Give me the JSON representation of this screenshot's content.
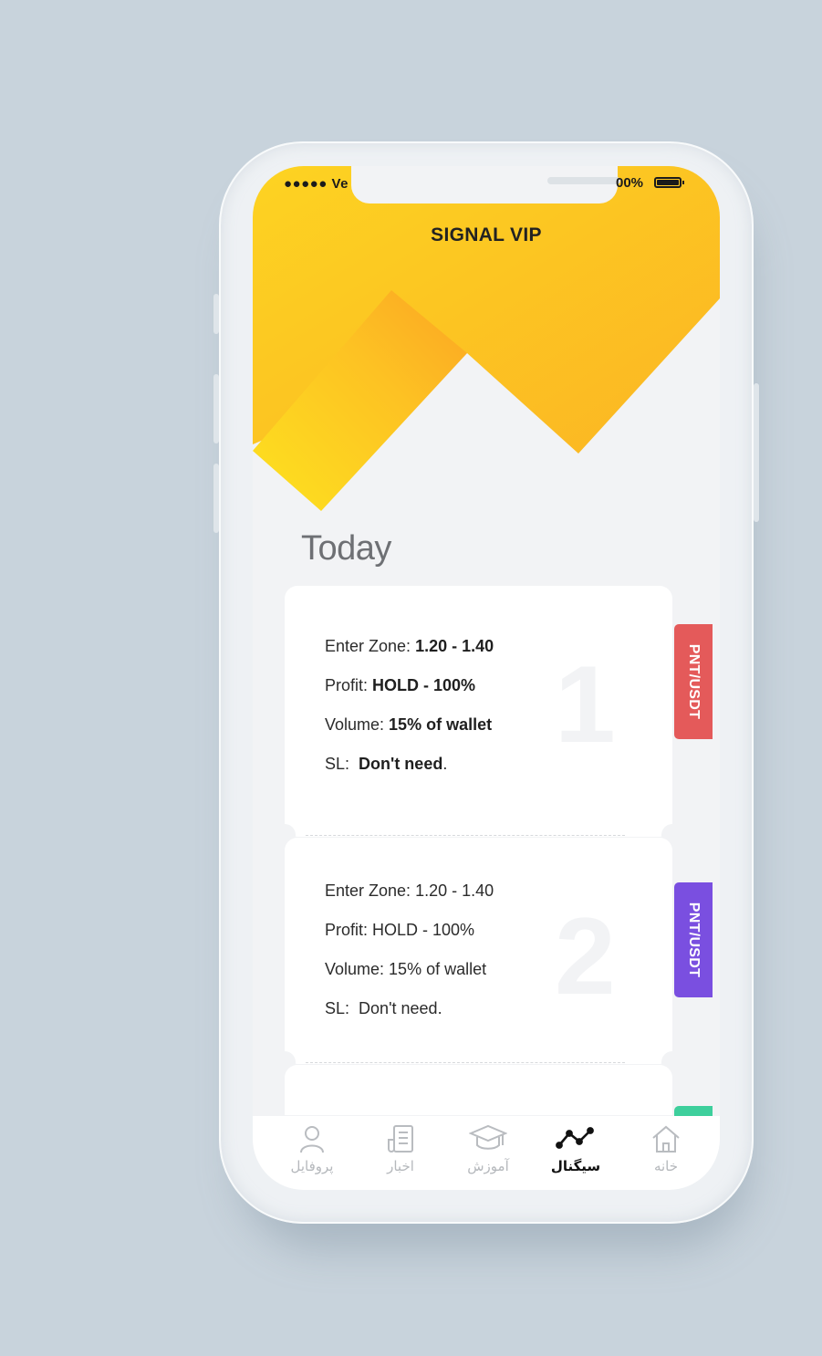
{
  "status_bar": {
    "carrier": "●●●●● Ve",
    "battery_text": "00%"
  },
  "app": {
    "title": "SIGNAL VIP",
    "accent_color": "#fcc21e"
  },
  "section": {
    "title": "Today"
  },
  "signals": [
    {
      "number": "1",
      "pair": "PNT/USDT",
      "tag_color": "#e45a5a",
      "enter_label": "Enter Zone:",
      "enter_value": " 1.20 - 1.40",
      "profit_label": "Profit:",
      "profit_value": " HOLD - 100%",
      "volume_label": "Volume:",
      "volume_value": " 15% of wallet",
      "sl_label": "SL:",
      "sl_value": "Don't need",
      "sl_suffix": "."
    },
    {
      "number": "2",
      "pair": "PNT/USDT",
      "tag_color": "#7a4fe0",
      "enter_label": "Enter Zone:",
      "enter_value": " 1.20 - 1.40",
      "profit_label": "Profit:",
      "profit_value": " HOLD - 100%",
      "volume_label": "Volume:",
      "volume_value": " 15% of wallet",
      "sl_label": "SL:",
      "sl_value": "Don't need",
      "sl_suffix": "."
    }
  ],
  "third_tag_color": "#3ecf9c",
  "tabs": [
    {
      "label": "پروفایل",
      "icon": "user-icon",
      "active": false
    },
    {
      "label": "اخبار",
      "icon": "news-icon",
      "active": false
    },
    {
      "label": "آموزش",
      "icon": "graduation-cap-icon",
      "active": false
    },
    {
      "label": "سیگنال",
      "icon": "signal-line-icon",
      "active": true
    },
    {
      "label": "خانه",
      "icon": "home-icon",
      "active": false
    }
  ]
}
